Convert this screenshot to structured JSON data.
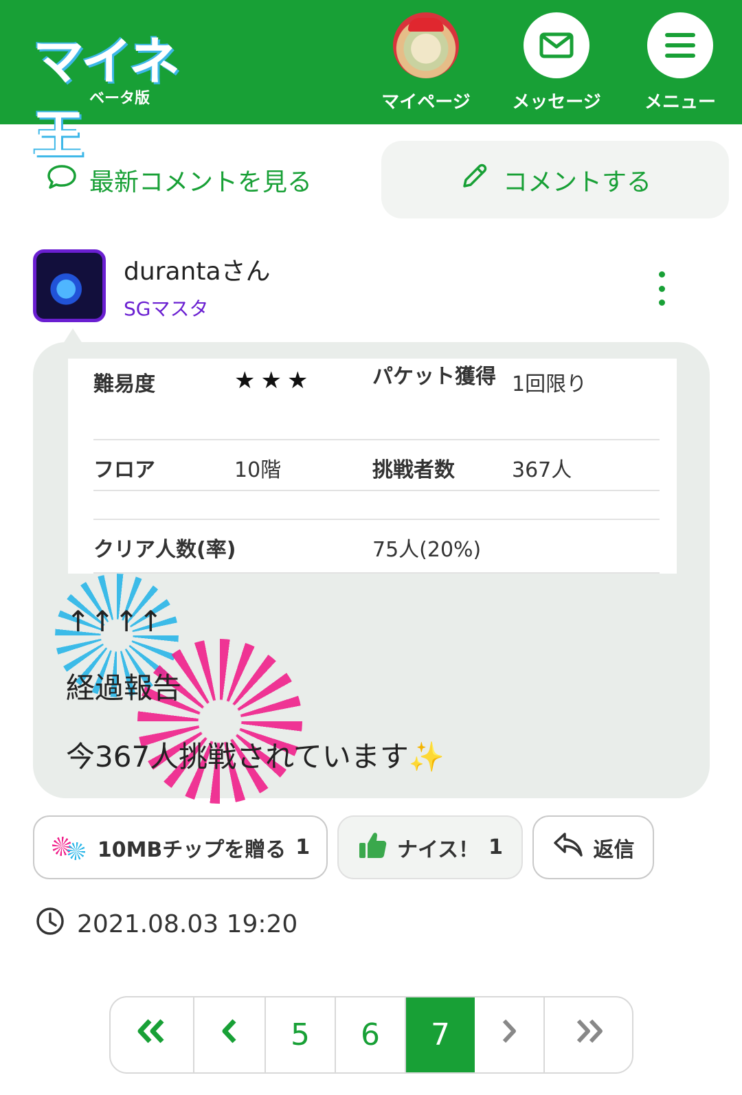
{
  "header": {
    "logo_text": "マイネ王",
    "logo_sub": "ベータ版",
    "nav": [
      {
        "label": "マイページ",
        "icon": "avatar"
      },
      {
        "label": "メッセージ",
        "icon": "envelope-icon"
      },
      {
        "label": "メニュー",
        "icon": "hamburger-icon"
      }
    ],
    "bg_color": "#18a036"
  },
  "actions": {
    "latest_comments": "最新コメントを見る",
    "write_comment": "コメントする"
  },
  "post": {
    "user_name": "durantaさん",
    "user_rank": "SGマスタ",
    "table": {
      "difficulty_label": "難易度",
      "difficulty_value": "★★★",
      "packet_label": "パケット獲得",
      "packet_value": "1回限り",
      "floor_label": "フロア",
      "floor_value": "10階",
      "challengers_label": "挑戦者数",
      "challengers_value": "367人",
      "clear_label": "クリア人数(率)",
      "clear_value": "75人(20%)"
    },
    "body_lines": [
      "↑↑↑↑",
      "経過報告",
      "今367人挑戦されています"
    ],
    "sparkle": "✨",
    "buttons": {
      "gift": "10MBチップを贈る",
      "gift_count": "1",
      "nice": "ナイス！",
      "nice_count": "1",
      "reply": "返信"
    },
    "timestamp": "2021.08.03 19:20"
  },
  "pagination": {
    "pages": [
      "5",
      "6",
      "7"
    ],
    "current": "7"
  },
  "colors": {
    "accent": "#18a036",
    "rank": "#6a1fd1",
    "bubble": "#e9edea"
  }
}
